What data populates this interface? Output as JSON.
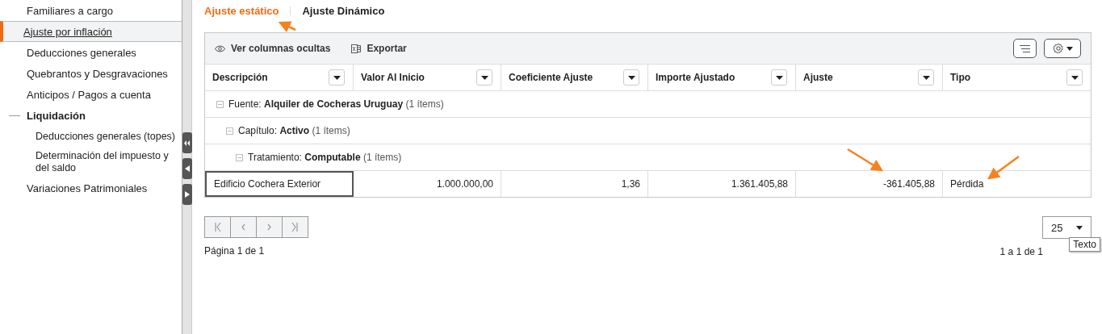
{
  "sidebar": {
    "items": [
      {
        "label": "Familiares a cargo",
        "selected": false
      },
      {
        "label": "Ajuste por inflación",
        "selected": true
      },
      {
        "label": "Deducciones generales",
        "selected": false
      },
      {
        "label": "Quebrantos y Desgravaciones",
        "selected": false
      },
      {
        "label": "Anticipos / Pagos a cuenta",
        "selected": false
      },
      {
        "label": "Liquidación",
        "selected": false,
        "expanded": true,
        "children": [
          {
            "label": "Deducciones generales (topes)",
            "selected": false
          },
          {
            "label": "Determinación del impuesto y del saldo",
            "selected": false
          }
        ]
      },
      {
        "label": "Variaciones Patrimoniales",
        "selected": false
      }
    ]
  },
  "tabs": [
    {
      "label": "Ajuste estático",
      "selected": true
    },
    {
      "label": "Ajuste Dinámico",
      "selected": false
    }
  ],
  "toolbar": {
    "buttons": [
      "Ver columnas ocultas",
      "Exportar"
    ]
  },
  "table": {
    "columns": [
      "Descripción",
      "Valor Al Inicio",
      "Coeficiente Ajuste",
      "Importe Ajustado",
      "Ajuste",
      "Tipo"
    ],
    "rows": [
      {
        "kind": "group",
        "field": "Fuente:",
        "value": "Alquiler de Cocheras Uruguay",
        "count": "(1 ítems)",
        "expanded": true,
        "children": [
          {
            "kind": "group",
            "field": "Capítulo:",
            "value": "Activo",
            "count": "(1 ítems)",
            "expanded": true,
            "children": [
              {
                "kind": "group",
                "field": "Tratamiento:",
                "value": "Computable",
                "count": "(1 ítems)",
                "expanded": true,
                "children": [
                  {
                    "kind": "data",
                    "cells": [
                      {
                        "text": "Edificio Cochera Exterior",
                        "focused": true
                      },
                      {
                        "text": "1.000.000,00",
                        "focused": false
                      },
                      {
                        "text": "1,36",
                        "focused": false
                      },
                      {
                        "text": "1.361.405,88",
                        "focused": false
                      },
                      {
                        "text": "-361.405,88",
                        "focused": false
                      },
                      {
                        "text": "Pérdida",
                        "focused": false
                      }
                    ]
                  }
                ]
              }
            ]
          }
        ]
      }
    ]
  },
  "pager": {
    "page_info": "Página 1 de 1",
    "page_size": "25",
    "tooltip": "Texto",
    "range": "1 a 1 de 1"
  }
}
